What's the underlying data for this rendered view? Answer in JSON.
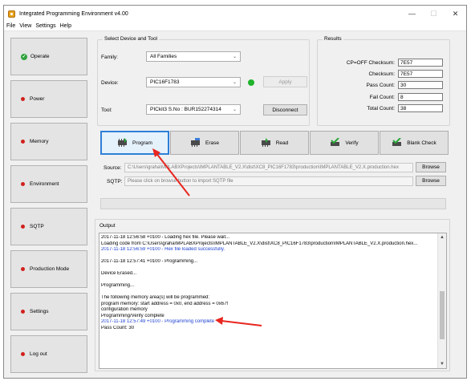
{
  "window": {
    "title": "Integrated Programming Environment v4.00",
    "controls": [
      "—",
      "☐",
      "✕"
    ]
  },
  "menu": [
    "File",
    "View",
    "Settings",
    "Help"
  ],
  "nav": [
    {
      "label": "Operate",
      "state": "ok"
    },
    {
      "label": "Power",
      "state": "error"
    },
    {
      "label": "Memory",
      "state": "error"
    },
    {
      "label": "Environment",
      "state": "error"
    },
    {
      "label": "SQTP",
      "state": "error"
    },
    {
      "label": "Production Mode",
      "state": "error"
    },
    {
      "label": "Settings",
      "state": "error"
    },
    {
      "label": "Log out",
      "state": "error"
    }
  ],
  "select_device": {
    "title": "Select Device and Tool",
    "family_label": "Family:",
    "family_value": "All Families",
    "device_label": "Device:",
    "device_value": "PIC16F1783",
    "apply_label": "Apply",
    "tool_label": "Tool:",
    "tool_value": "PICkit3 S.No : BUR152274314",
    "disconnect_label": "Disconnect"
  },
  "results": {
    "title": "Results",
    "rows": [
      {
        "label": "CP=OFF Checksum:",
        "value": "7E57"
      },
      {
        "label": "Checksum:",
        "value": "7E57"
      },
      {
        "label": "Pass Count:",
        "value": "30"
      },
      {
        "label": "Fail Count:",
        "value": "8"
      },
      {
        "label": "Total Count:",
        "value": "38"
      }
    ]
  },
  "actions": [
    {
      "label": "Program",
      "icon": "program-icon"
    },
    {
      "label": "Erase",
      "icon": "erase-icon"
    },
    {
      "label": "Read",
      "icon": "read-icon"
    },
    {
      "label": "Verify",
      "icon": "verify-icon"
    },
    {
      "label": "Blank Check",
      "icon": "blank-check-icon"
    }
  ],
  "source": {
    "label": "Source:",
    "value": "C:\\Users\\graha\\MPLABXProjects\\IMPLANTABLE_V2.X\\dist\\XC8_PIC16F1783\\production\\IMPLANTABLE_V2.X.production.hex",
    "browse": "Browse"
  },
  "sqtp": {
    "label": "SQTP:",
    "value": "Please click on browse button to import SQTP file",
    "browse": "Browse"
  },
  "output": {
    "title": "Output",
    "lines": [
      {
        "text": "2017-11-18 12:56:58 +0100 - Loading hex file. Please wait...",
        "color": "black"
      },
      {
        "text": "Loading code from C:\\Users\\graha\\MPLABXProjects\\IMPLANTABLE_V2.X\\dist\\XC8_PIC16F1783\\production\\IMPLANTABLE_V2.X.production.hex...",
        "color": "black"
      },
      {
        "text": "2017-11-18 12:56:59 +0100 - Hex file loaded successfully.",
        "color": "blue"
      },
      {
        "text": "",
        "color": "black"
      },
      {
        "text": "2017-11-18 12:57:41 +0100 - Programming...",
        "color": "black"
      },
      {
        "text": "",
        "color": "black"
      },
      {
        "text": "Device Erased...",
        "color": "black"
      },
      {
        "text": "",
        "color": "black"
      },
      {
        "text": "Programming...",
        "color": "black"
      },
      {
        "text": "",
        "color": "black"
      },
      {
        "text": "The following memory area(s) will be programmed:",
        "color": "black"
      },
      {
        "text": "program memory: start address = 0x0, end address = 0x67f",
        "color": "black"
      },
      {
        "text": "configuration memory",
        "color": "black"
      },
      {
        "text": "Programming/Verify complete",
        "color": "black"
      },
      {
        "text": "2017-11-18 12:57:49 +0100 - Programming complete",
        "color": "blue"
      },
      {
        "text": "Pass Count: 30",
        "color": "black"
      }
    ]
  },
  "colors": {
    "accent_focus": "#2f7fd8",
    "status_ok": "#2fa33d",
    "status_error": "#d0211c",
    "log_blue": "#1a3fd1",
    "annotation_red": "#e8261f"
  }
}
